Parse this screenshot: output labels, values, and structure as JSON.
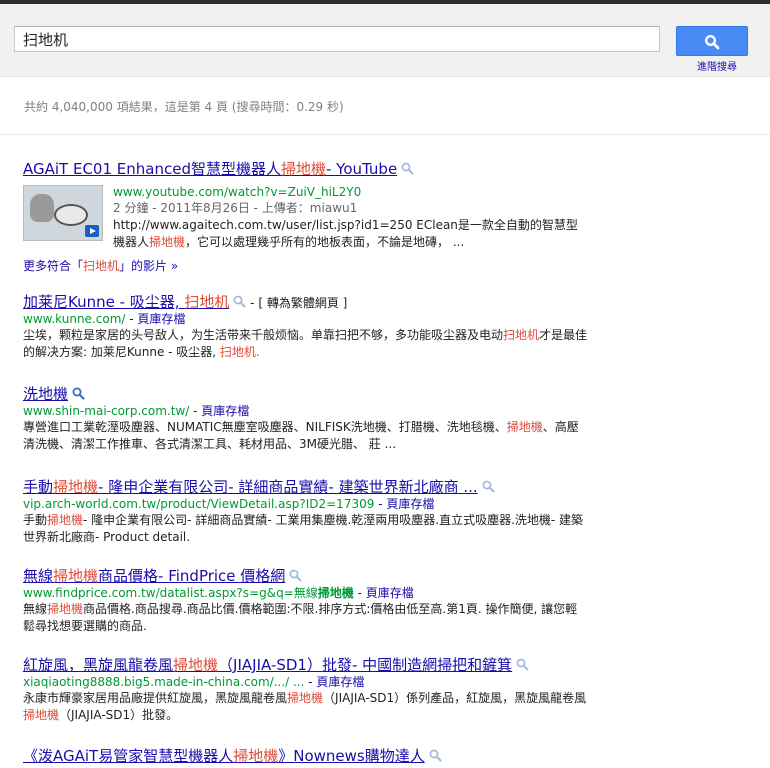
{
  "search": {
    "query": "扫地机",
    "advanced_label": "進階搜尋"
  },
  "stats": "共約 4,040,000 項結果，這是第 4 頁 (搜尋時間：0.29 秒)",
  "colors": {
    "link": "#1a0dab",
    "url": "#009933",
    "highlight": "#dd4b39",
    "button": "#4a8af4"
  },
  "results": [
    {
      "title_pre": "AGAiT EC01 Enhanced智慧型機器人",
      "title_hl": "掃地機",
      "title_post": "- YouTube",
      "url": "www.youtube.com/watch?v=ZuiV_hiL2Y0",
      "meta": "2 分鐘 - 2011年8月26日 - 上傳者：miawu1",
      "snippet_a": "http://www.agaitech.com.tw/user/list.jsp?id1=250 EClean是一款全自動的智慧型機器人",
      "snippet_hl": "掃地機",
      "snippet_b": "，它可以處理幾乎所有的地板表面，不論是地磚，  ..."
    },
    {
      "title_pre": "加莱尼Kunne - 吸尘器, ",
      "title_hl": "扫地机",
      "translate": "- [ 轉為繁體網頁 ]",
      "url": "www.kunne.com/",
      "cache": "- 頁庫存檔",
      "snippet_a": "尘埃，颗粒是家居的头号敌人，为生活带来千般烦恼。单靠扫把不够，多功能吸尘器及电动",
      "snippet_hl": "扫地机",
      "snippet_b": "才是最佳的解决方案: 加莱尼Kunne - 吸尘器, ",
      "snippet_hl2": "扫地机."
    },
    {
      "title": "洗地機",
      "url": "www.shin-mai-corp.com.tw/",
      "cache": "- 頁庫存檔",
      "snippet_a": "專營進口工業乾溼吸塵器、NUMATIC無塵室吸塵器、NILFISK洗地機、打腊機、洗地毯機、",
      "snippet_hl": "掃地機",
      "snippet_b": "、高壓清洗機、清潔工作推車、各式清潔工具、耗材用品、3M硬光腊、 莊 ..."
    },
    {
      "title_pre": "手動",
      "title_hl": "掃地機",
      "title_post": "- 隆申企業有限公司- 詳細商品實績- 建築世界新北廠商 ...",
      "url": "vip.arch-world.com.tw/product/ViewDetail.asp?ID2=17309",
      "cache": "- 頁庫存檔",
      "snippet_a": "手動",
      "snippet_hl": "掃地機",
      "snippet_b": "- 隆申企業有限公司- 詳細商品實績- 工業用集塵機.乾溼兩用吸塵器.直立式吸塵器.洗地機- 建築世界新北廠商- Product detail."
    },
    {
      "title_pre": "無線",
      "title_hl": "掃地機",
      "title_post": "商品價格- FindPrice 價格網",
      "url_pre": "www.findprice.com.tw/datalist.aspx?s=g&q=無線",
      "url_bold": "掃地機",
      "cache": "- 頁庫存檔",
      "snippet_a": "無線",
      "snippet_hl": "掃地機",
      "snippet_b": "商品價格.商品搜尋.商品比價.價格範圍:不限.排序方式:價格由低至高.第1頁. 操作簡便, 讓您輕鬆尋找想要選購的商品."
    },
    {
      "title_pre": "紅旋風，黑旋風龍卷風",
      "title_hl": "掃地機",
      "title_post": "（JIAJIA-SD1）批發- 中國制造網掃把和鏟箕",
      "url": "xiaqiaoting8888.big5.made-in-china.com/.../ ...",
      "cache": "- 頁庫存檔",
      "snippet_a": "永康市輝豪家居用品廠提供紅旋風，黑旋風龍卷風",
      "snippet_hl": "掃地機",
      "snippet_b": "（JIAJIA-SD1）係列產品，紅旋風，黑旋風龍卷風",
      "snippet_hl2": "掃地機",
      "snippet_c": "（JIAJIA-SD1）批發。"
    },
    {
      "title_pre": "《泼AGAiT易管家智慧型機器人",
      "title_hl": "掃地機",
      "title_post": "》Nownews購物達人"
    }
  ],
  "more_videos": {
    "pre": "更多符合「",
    "hl": "扫地机",
    "post": "」的影片 »"
  }
}
